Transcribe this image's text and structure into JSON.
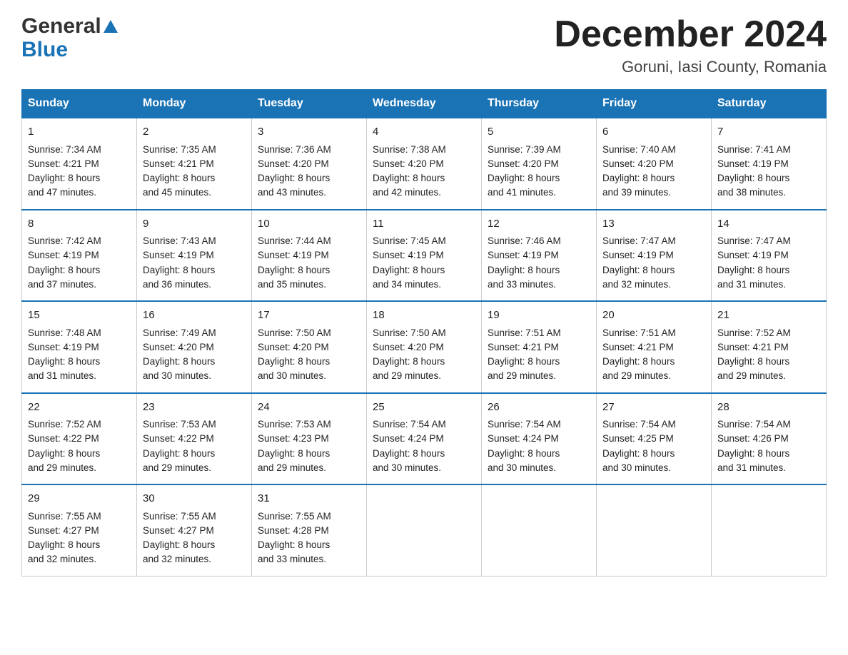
{
  "header": {
    "title": "December 2024",
    "subtitle": "Goruni, Iasi County, Romania",
    "logo_line1": "General",
    "logo_line2": "Blue"
  },
  "columns": [
    "Sunday",
    "Monday",
    "Tuesday",
    "Wednesday",
    "Thursday",
    "Friday",
    "Saturday"
  ],
  "weeks": [
    [
      {
        "day": "1",
        "sunrise": "7:34 AM",
        "sunset": "4:21 PM",
        "daylight": "8 hours and 47 minutes."
      },
      {
        "day": "2",
        "sunrise": "7:35 AM",
        "sunset": "4:21 PM",
        "daylight": "8 hours and 45 minutes."
      },
      {
        "day": "3",
        "sunrise": "7:36 AM",
        "sunset": "4:20 PM",
        "daylight": "8 hours and 43 minutes."
      },
      {
        "day": "4",
        "sunrise": "7:38 AM",
        "sunset": "4:20 PM",
        "daylight": "8 hours and 42 minutes."
      },
      {
        "day": "5",
        "sunrise": "7:39 AM",
        "sunset": "4:20 PM",
        "daylight": "8 hours and 41 minutes."
      },
      {
        "day": "6",
        "sunrise": "7:40 AM",
        "sunset": "4:20 PM",
        "daylight": "8 hours and 39 minutes."
      },
      {
        "day": "7",
        "sunrise": "7:41 AM",
        "sunset": "4:19 PM",
        "daylight": "8 hours and 38 minutes."
      }
    ],
    [
      {
        "day": "8",
        "sunrise": "7:42 AM",
        "sunset": "4:19 PM",
        "daylight": "8 hours and 37 minutes."
      },
      {
        "day": "9",
        "sunrise": "7:43 AM",
        "sunset": "4:19 PM",
        "daylight": "8 hours and 36 minutes."
      },
      {
        "day": "10",
        "sunrise": "7:44 AM",
        "sunset": "4:19 PM",
        "daylight": "8 hours and 35 minutes."
      },
      {
        "day": "11",
        "sunrise": "7:45 AM",
        "sunset": "4:19 PM",
        "daylight": "8 hours and 34 minutes."
      },
      {
        "day": "12",
        "sunrise": "7:46 AM",
        "sunset": "4:19 PM",
        "daylight": "8 hours and 33 minutes."
      },
      {
        "day": "13",
        "sunrise": "7:47 AM",
        "sunset": "4:19 PM",
        "daylight": "8 hours and 32 minutes."
      },
      {
        "day": "14",
        "sunrise": "7:47 AM",
        "sunset": "4:19 PM",
        "daylight": "8 hours and 31 minutes."
      }
    ],
    [
      {
        "day": "15",
        "sunrise": "7:48 AM",
        "sunset": "4:19 PM",
        "daylight": "8 hours and 31 minutes."
      },
      {
        "day": "16",
        "sunrise": "7:49 AM",
        "sunset": "4:20 PM",
        "daylight": "8 hours and 30 minutes."
      },
      {
        "day": "17",
        "sunrise": "7:50 AM",
        "sunset": "4:20 PM",
        "daylight": "8 hours and 30 minutes."
      },
      {
        "day": "18",
        "sunrise": "7:50 AM",
        "sunset": "4:20 PM",
        "daylight": "8 hours and 29 minutes."
      },
      {
        "day": "19",
        "sunrise": "7:51 AM",
        "sunset": "4:21 PM",
        "daylight": "8 hours and 29 minutes."
      },
      {
        "day": "20",
        "sunrise": "7:51 AM",
        "sunset": "4:21 PM",
        "daylight": "8 hours and 29 minutes."
      },
      {
        "day": "21",
        "sunrise": "7:52 AM",
        "sunset": "4:21 PM",
        "daylight": "8 hours and 29 minutes."
      }
    ],
    [
      {
        "day": "22",
        "sunrise": "7:52 AM",
        "sunset": "4:22 PM",
        "daylight": "8 hours and 29 minutes."
      },
      {
        "day": "23",
        "sunrise": "7:53 AM",
        "sunset": "4:22 PM",
        "daylight": "8 hours and 29 minutes."
      },
      {
        "day": "24",
        "sunrise": "7:53 AM",
        "sunset": "4:23 PM",
        "daylight": "8 hours and 29 minutes."
      },
      {
        "day": "25",
        "sunrise": "7:54 AM",
        "sunset": "4:24 PM",
        "daylight": "8 hours and 30 minutes."
      },
      {
        "day": "26",
        "sunrise": "7:54 AM",
        "sunset": "4:24 PM",
        "daylight": "8 hours and 30 minutes."
      },
      {
        "day": "27",
        "sunrise": "7:54 AM",
        "sunset": "4:25 PM",
        "daylight": "8 hours and 30 minutes."
      },
      {
        "day": "28",
        "sunrise": "7:54 AM",
        "sunset": "4:26 PM",
        "daylight": "8 hours and 31 minutes."
      }
    ],
    [
      {
        "day": "29",
        "sunrise": "7:55 AM",
        "sunset": "4:27 PM",
        "daylight": "8 hours and 32 minutes."
      },
      {
        "day": "30",
        "sunrise": "7:55 AM",
        "sunset": "4:27 PM",
        "daylight": "8 hours and 32 minutes."
      },
      {
        "day": "31",
        "sunrise": "7:55 AM",
        "sunset": "4:28 PM",
        "daylight": "8 hours and 33 minutes."
      },
      null,
      null,
      null,
      null
    ]
  ],
  "labels": {
    "sunrise": "Sunrise:",
    "sunset": "Sunset:",
    "daylight": "Daylight:"
  }
}
